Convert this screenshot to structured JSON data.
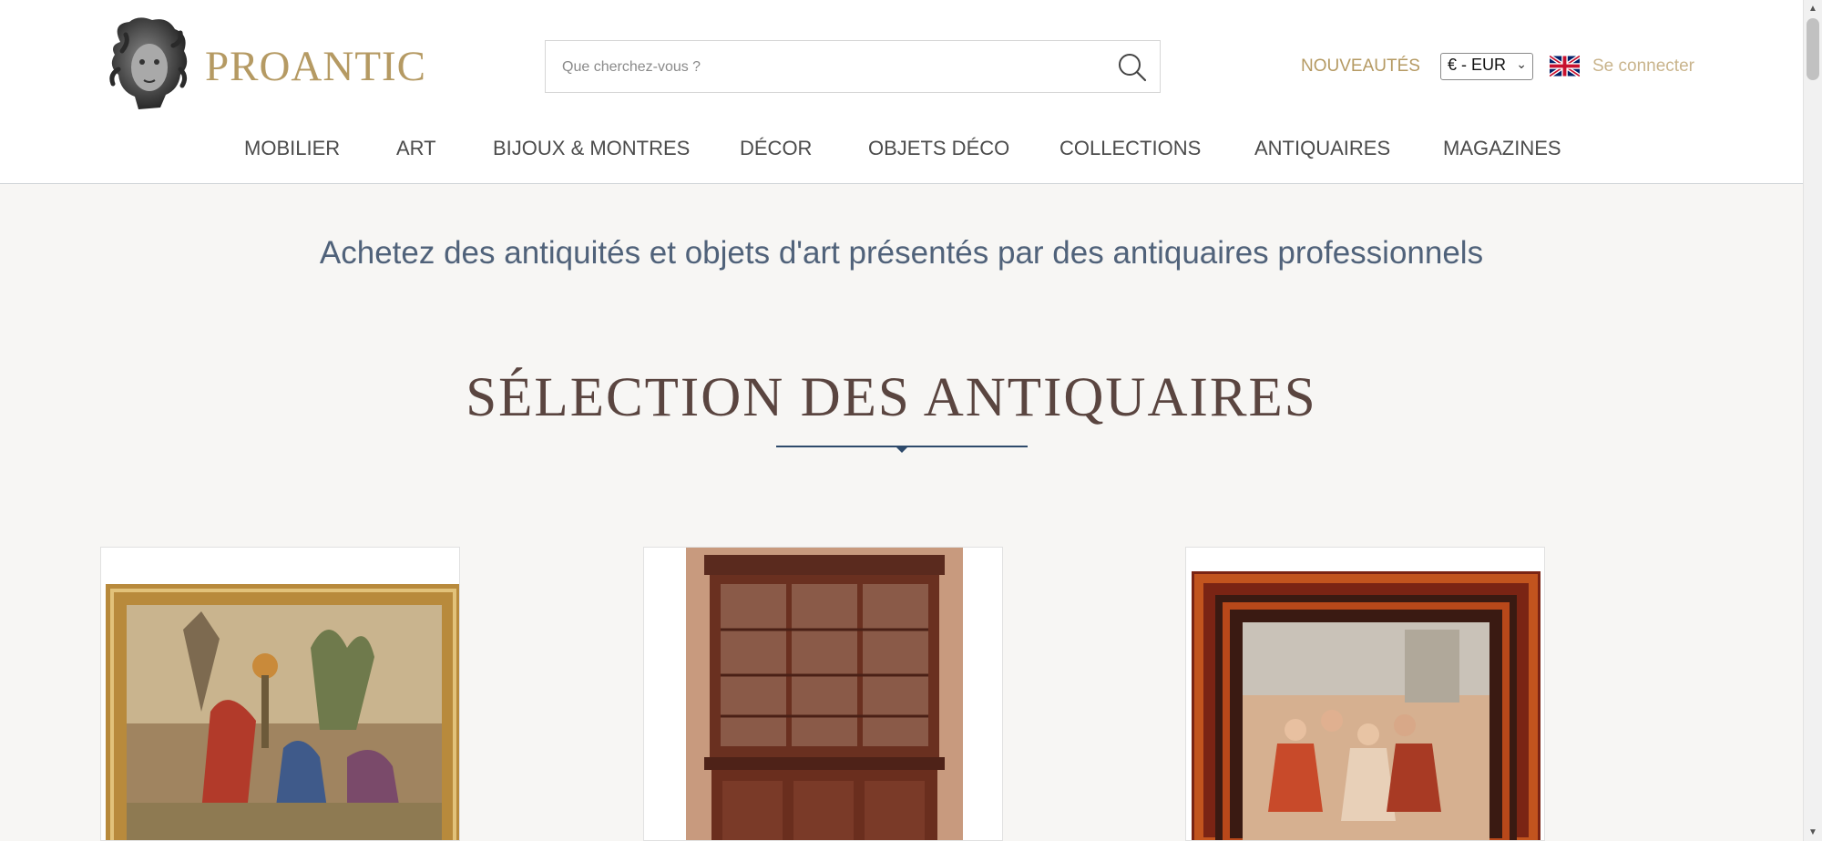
{
  "header": {
    "brand": "PROANTIC",
    "search_placeholder": "Que cherchez-vous ?",
    "nouveautes": "NOUVEAUTÉS",
    "currency": "€ - EUR",
    "login": "Se connecter"
  },
  "nav": {
    "items": [
      {
        "label": "MOBILIER"
      },
      {
        "label": "ART"
      },
      {
        "label": "BIJOUX & MONTRES"
      },
      {
        "label": "DÉCOR"
      },
      {
        "label": "OBJETS DÉCO"
      },
      {
        "label": "COLLECTIONS"
      },
      {
        "label": "ANTIQUAIRES"
      },
      {
        "label": "MAGAZINES"
      }
    ]
  },
  "main": {
    "tagline": "Achetez des antiquités et objets d'art présentés par des antiquaires professionnels",
    "section_title": "SÉLECTION DES ANTIQUAIRES"
  },
  "colors": {
    "brand_gold": "#b59a63",
    "title_navy": "#2e4a6b",
    "tagline_blue": "#50627a"
  },
  "icons": {
    "search": "search-icon",
    "flag": "uk-flag-icon",
    "logo": "medusa-head-logo"
  }
}
